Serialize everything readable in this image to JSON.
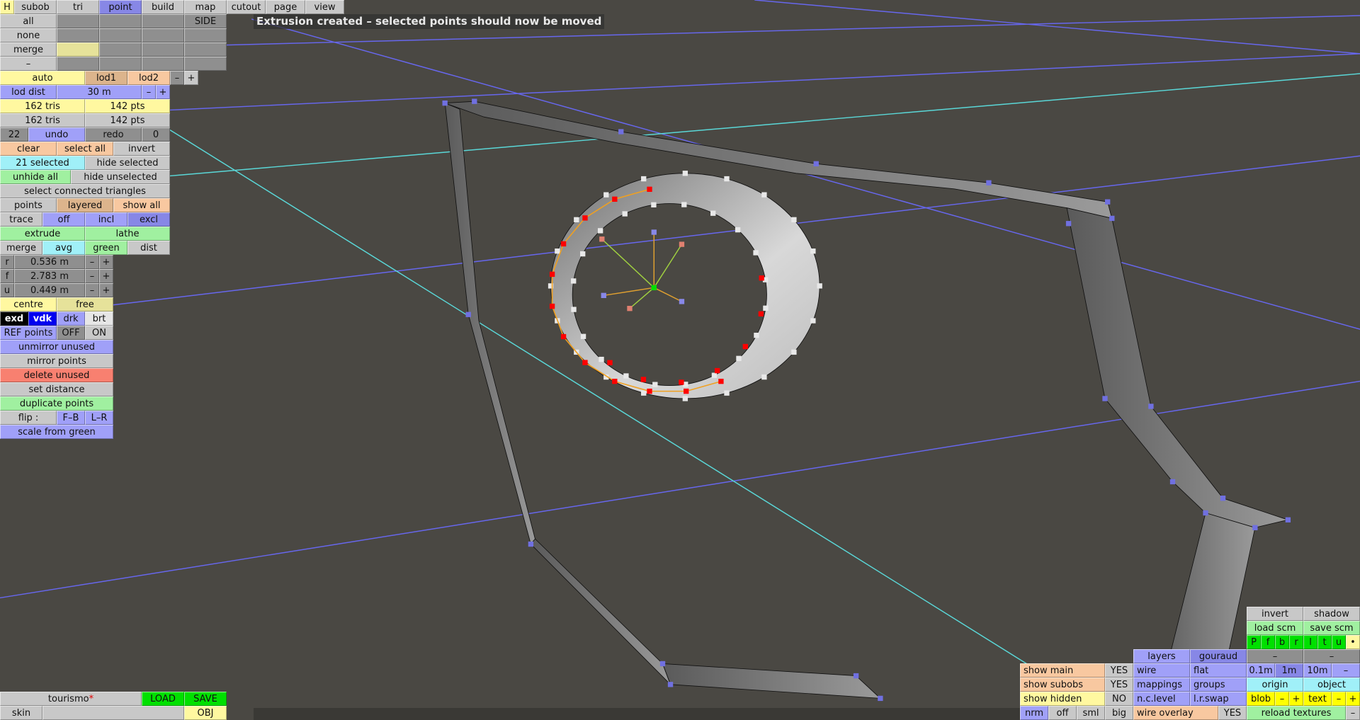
{
  "toolbar": {
    "tabs": [
      "H",
      "subob",
      "tri",
      "point",
      "build",
      "map",
      "cutout",
      "page",
      "view"
    ]
  },
  "select": {
    "all": "all",
    "none": "none",
    "merge": "merge",
    "dash": "–",
    "side": "SIDE"
  },
  "lod": {
    "auto": "auto",
    "lod1": "lod1",
    "lod2": "lod2",
    "minus": "–",
    "plus": "+",
    "dist_label": "lod dist",
    "dist_value": "30 m"
  },
  "stats": {
    "tris1": "162 tris",
    "pts1": "142 pts",
    "tris2": "162 tris",
    "pts2": "142 pts"
  },
  "undo": {
    "count": "22",
    "undo": "undo",
    "redo": "redo",
    "redo_count": "0"
  },
  "sel": {
    "clear": "clear",
    "select_all": "select all",
    "invert": "invert",
    "selected": "21 selected",
    "hide_selected": "hide selected",
    "unhide_all": "unhide all",
    "hide_unselected": "hide unselected",
    "select_connected": "select connected triangles"
  },
  "points_row": {
    "points": "points",
    "layered": "layered",
    "show_all": "show all"
  },
  "trace": {
    "trace": "trace",
    "off": "off",
    "incl": "incl",
    "excl": "excl"
  },
  "ops": {
    "extrude": "extrude",
    "lathe": "lathe",
    "merge": "merge",
    "avg": "avg",
    "green": "green",
    "dist": "dist"
  },
  "rfu": [
    {
      "label": "r",
      "value": "0.536 m"
    },
    {
      "label": "f",
      "value": "2.783 m"
    },
    {
      "label": "u",
      "value": "0.449 m"
    }
  ],
  "misc": {
    "minus": "–",
    "plus": "+",
    "centre": "centre",
    "free": "free",
    "exd": "exd",
    "vdk": "vdk",
    "drk": "drk",
    "brt": "brt",
    "ref_points": "REF points",
    "off": "OFF",
    "on": "ON",
    "unmirror_unused": "unmirror unused",
    "mirror_points": "mirror points",
    "delete_unused": "delete unused",
    "set_distance": "set distance",
    "duplicate_points": "duplicate points",
    "flip": "flip :",
    "fb": "F–B",
    "lr": "L–R",
    "scale_from_green": "scale from green"
  },
  "status": {
    "message": "Extrusion created – selected points should now be moved"
  },
  "file": {
    "name": "tourismo",
    "modified": "*",
    "load": "LOAD",
    "save": "SAVE",
    "skin": "skin",
    "obj": "OBJ"
  },
  "right": {
    "invert": "invert",
    "shadow": "shadow",
    "load_scm": "load scm",
    "save_scm": "save scm",
    "views": [
      "P",
      "f",
      "b",
      "r",
      "l",
      "t",
      "u",
      "•"
    ],
    "dash": "–",
    "layers": "layers",
    "gouraud": "gouraud",
    "wire": "wire",
    "flat": "flat",
    "mappings": "mappings",
    "groups": "groups",
    "nclevel": "n.c.level",
    "lrswap": "l.r.swap",
    "show_main": "show main",
    "show_subobs": "show subobs",
    "show_hidden": "show hidden",
    "yes": "YES",
    "no": "NO",
    "g01": "0.1m",
    "g1": "1m",
    "g10": "10m",
    "origin": "origin",
    "object": "object",
    "blob": "blob",
    "text": "text",
    "minus": "–",
    "plus": "+",
    "nrm": "nrm",
    "off": "off",
    "sml": "sml",
    "big": "big",
    "wire_overlay": "wire overlay",
    "reload_textures": "reload textures"
  }
}
